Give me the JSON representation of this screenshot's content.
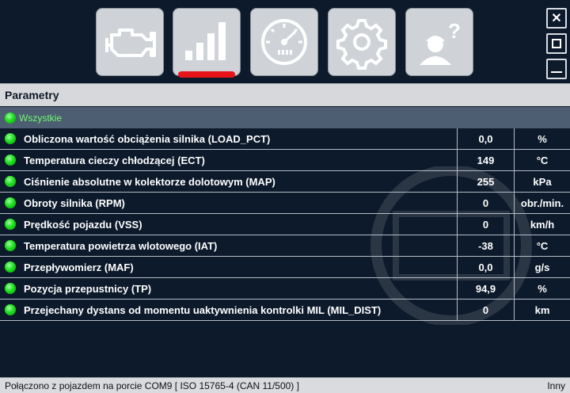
{
  "toolbar": {
    "buttons": [
      {
        "name": "engine-diagnostics",
        "icon": "engine-icon",
        "active": false
      },
      {
        "name": "parameters",
        "icon": "signal-bars-icon",
        "active": true
      },
      {
        "name": "gauge",
        "icon": "gauge-icon",
        "active": false
      },
      {
        "name": "settings",
        "icon": "gear-icon",
        "active": false
      },
      {
        "name": "help",
        "icon": "user-help-icon",
        "active": false
      }
    ],
    "accent": "#e8141a"
  },
  "window": {
    "close_label": "✕",
    "maximize_label": "☐",
    "minimize_label": "—"
  },
  "section": {
    "title": "Parametry",
    "group_label": "Wszystkie"
  },
  "parameters": [
    {
      "name": "Obliczona wartość obciążenia silnika (LOAD_PCT)",
      "value": "0,0",
      "unit": "%"
    },
    {
      "name": "Temperatura cieczy chłodzącej (ECT)",
      "value": "149",
      "unit": "°C"
    },
    {
      "name": "Ciśnienie absolutne w kolektorze dolotowym (MAP)",
      "value": "255",
      "unit": "kPa"
    },
    {
      "name": "Obroty silnika (RPM)",
      "value": "0",
      "unit": "obr./min."
    },
    {
      "name": "Prędkość pojazdu (VSS)",
      "value": "0",
      "unit": "km/h"
    },
    {
      "name": "Temperatura powietrza wlotowego (IAT)",
      "value": "-38",
      "unit": "°C"
    },
    {
      "name": "Przepływomierz (MAF)",
      "value": "0,0",
      "unit": "g/s"
    },
    {
      "name": "Pozycja przepustnicy (TP)",
      "value": "94,9",
      "unit": "%"
    },
    {
      "name": "Przejechany dystans od momentu uaktywnienia kontrolki MIL (MIL_DIST)",
      "value": "0",
      "unit": "km"
    }
  ],
  "status": {
    "connection": "Połączono z pojazdem na porcie COM9  [ ISO 15765-4 (CAN 11/500) ]",
    "right": "Inny"
  },
  "colors": {
    "background": "#0d1a2b",
    "group_row": "#4d5d72",
    "status_dot": "#1fe01f"
  }
}
